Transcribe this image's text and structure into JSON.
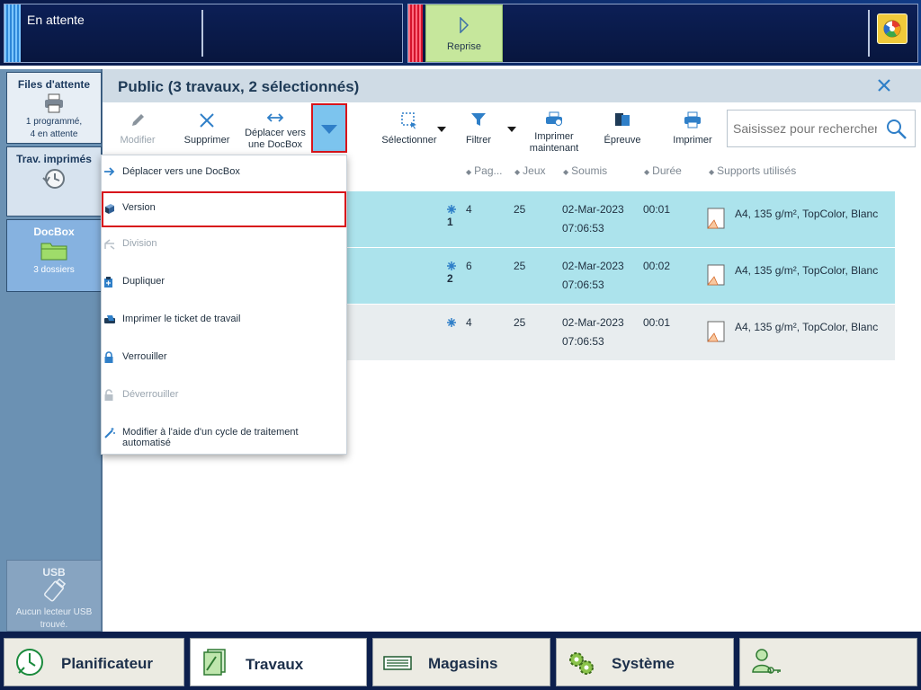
{
  "topbar": {
    "status_title": "En attente",
    "resume_label": "Reprise",
    "status_icon": "color-wheel-icon"
  },
  "sidebar": {
    "queues": {
      "title": "Files d'attente",
      "line1": "1 programmé,",
      "line2": "4 en attente"
    },
    "printed": {
      "title": "Trav. imprimés"
    },
    "docbox": {
      "title": "DocBox",
      "sub": "3 dossiers"
    },
    "usb": {
      "title": "USB",
      "line1": "Aucun lecteur USB",
      "line2": "trouvé."
    }
  },
  "main": {
    "title": "Public (3 travaux, 2 sélectionnés)"
  },
  "toolbar": {
    "modify": "Modifier",
    "delete": "Supprimer",
    "move_line1": "Déplacer vers",
    "move_line2": "une DocBox",
    "select": "Sélectionner",
    "filter": "Filtrer",
    "print_now_line1": "Imprimer",
    "print_now_line2": "maintenant",
    "proof": "Épreuve",
    "print": "Imprimer",
    "search_placeholder": "Saisissez pour rechercher"
  },
  "columns": {
    "pages": "Pag...",
    "sets": "Jeux",
    "submitted": "Soumis",
    "duration": "Durée",
    "media": "Supports utilisés"
  },
  "rows": [
    {
      "order": "1",
      "pages": "4",
      "sets": "25",
      "date": "02-Mar-2023",
      "time": "07:06:53",
      "duration": "00:01",
      "media": "A4, 135 g/m², TopColor, Blanc",
      "selected": true
    },
    {
      "order": "2",
      "pages": "6",
      "sets": "25",
      "date": "02-Mar-2023",
      "time": "07:06:53",
      "duration": "00:02",
      "media": "A4, 135 g/m², TopColor, Blanc",
      "selected": true
    },
    {
      "order": "",
      "pages": "4",
      "sets": "25",
      "date": "02-Mar-2023",
      "time": "07:06:53",
      "duration": "00:01",
      "media": "A4, 135 g/m², TopColor, Blanc",
      "selected": false
    }
  ],
  "menu": {
    "move_docbox": "Déplacer vers une DocBox",
    "version": "Version",
    "split": "Division",
    "duplicate": "Dupliquer",
    "print_ticket": "Imprimer le ticket de travail",
    "lock": "Verrouiller",
    "unlock": "Déverrouiller",
    "automated": "Modifier à l'aide d'un cycle de traitement automatisé"
  },
  "bottomnav": {
    "scheduler": "Planificateur",
    "jobs": "Travaux",
    "trays": "Magasins",
    "system": "Système"
  },
  "colors": {
    "selected_row": "#ace3ec",
    "plain_row": "#e8edef",
    "highlight": "#d8141b",
    "accent": "#2f7fc8"
  }
}
